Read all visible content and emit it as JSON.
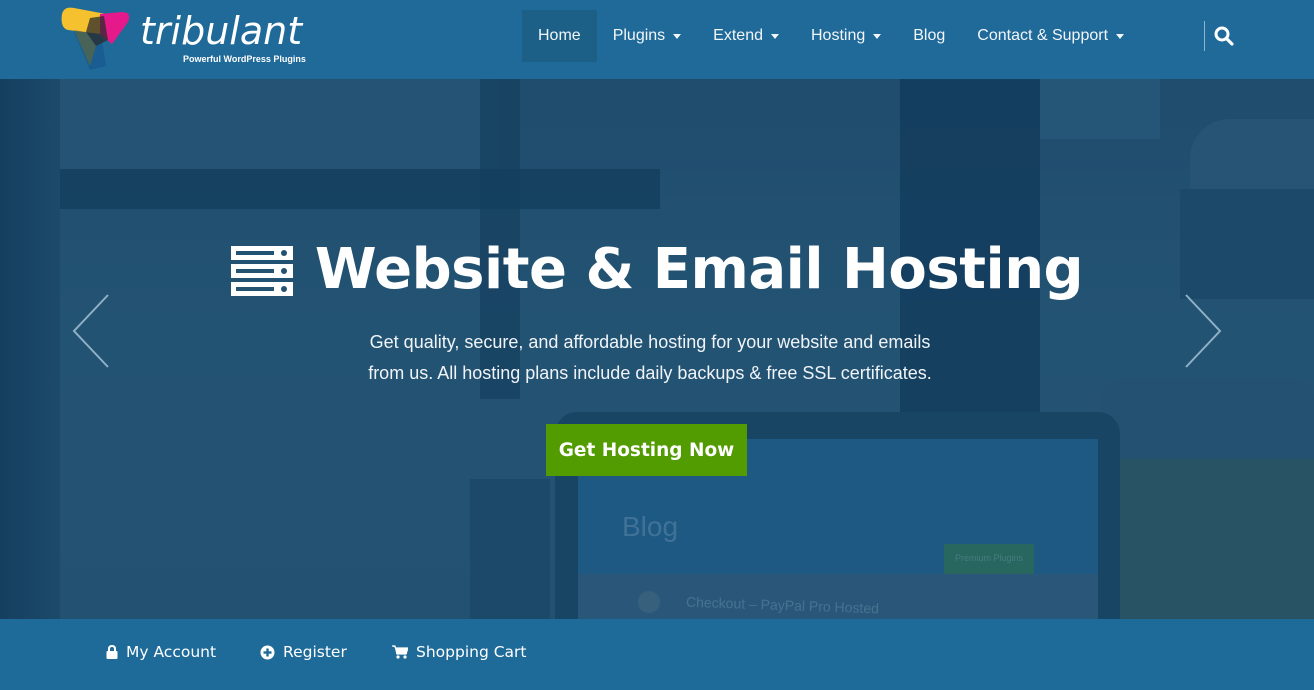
{
  "brand": {
    "name": "tribulant",
    "tagline": "Powerful WordPress Plugins",
    "colors": {
      "yellow": "#f5c12e",
      "magenta": "#e6198a",
      "blue": "#1a5d93"
    }
  },
  "nav": {
    "items": [
      {
        "label": "Home",
        "active": true,
        "dropdown": false
      },
      {
        "label": "Plugins",
        "active": false,
        "dropdown": true
      },
      {
        "label": "Extend",
        "active": false,
        "dropdown": true
      },
      {
        "label": "Hosting",
        "active": false,
        "dropdown": true
      },
      {
        "label": "Blog",
        "active": false,
        "dropdown": false
      },
      {
        "label": "Contact & Support",
        "active": false,
        "dropdown": true
      }
    ],
    "search_icon": "search-icon"
  },
  "hero": {
    "icon": "server-icon",
    "title": "Website & Email Hosting",
    "subtitle_line1": "Get quality, secure, and affordable hosting for your website and emails",
    "subtitle_line2": "from us. All hosting plans include daily backups & free SSL certificates.",
    "cta_label": "Get Hosting Now",
    "cta_color": "#529b00",
    "prev_icon": "chevron-left-icon",
    "next_icon": "chevron-right-icon",
    "background_laptop_text": {
      "blog_heading": "Blog",
      "post_title": "Checkout – PayPal Pro Hosted",
      "button": "Premium Plugins"
    }
  },
  "bottom_bar": {
    "items": [
      {
        "label": "My Account",
        "icon": "lock-icon"
      },
      {
        "label": "Register",
        "icon": "plus-circle-icon"
      },
      {
        "label": "Shopping Cart",
        "icon": "cart-icon"
      }
    ]
  },
  "theme": {
    "header_bg": "#1f6a98",
    "active_nav_bg": "#1c6088",
    "hero_overlay": "#245272"
  }
}
